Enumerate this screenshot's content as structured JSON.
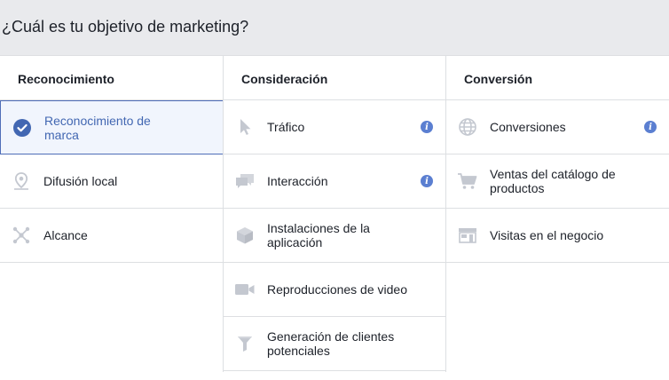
{
  "header": {
    "title": "¿Cuál es tu objetivo de marketing?"
  },
  "columns": [
    {
      "heading": "Reconocimiento",
      "items": [
        {
          "label": "Reconocimiento de marca",
          "icon": "check-circle-icon"
        },
        {
          "label": "Difusión local",
          "icon": "map-pin-icon"
        },
        {
          "label": "Alcance",
          "icon": "network-icon"
        }
      ]
    },
    {
      "heading": "Consideración",
      "items": [
        {
          "label": "Tráfico",
          "icon": "cursor-icon"
        },
        {
          "label": "Interacción",
          "icon": "chat-bubbles-icon"
        },
        {
          "label": "Instalaciones de la aplicación",
          "icon": "box-icon"
        },
        {
          "label": "Reproducciones de video",
          "icon": "video-camera-icon"
        },
        {
          "label": "Generación de clientes potenciales",
          "icon": "funnel-icon"
        }
      ]
    },
    {
      "heading": "Conversión",
      "items": [
        {
          "label": "Conversiones",
          "icon": "globe-icon"
        },
        {
          "label": "Ventas del catálogo de productos",
          "icon": "shopping-cart-icon"
        },
        {
          "label": "Visitas en el negocio",
          "icon": "store-icon"
        }
      ]
    }
  ],
  "info_glyph": "i",
  "colors": {
    "accent": "#4267b2",
    "selected_bg": "#f1f5fd",
    "icon_gray": "#c4c8d0",
    "header_bg": "#e9eaed"
  }
}
